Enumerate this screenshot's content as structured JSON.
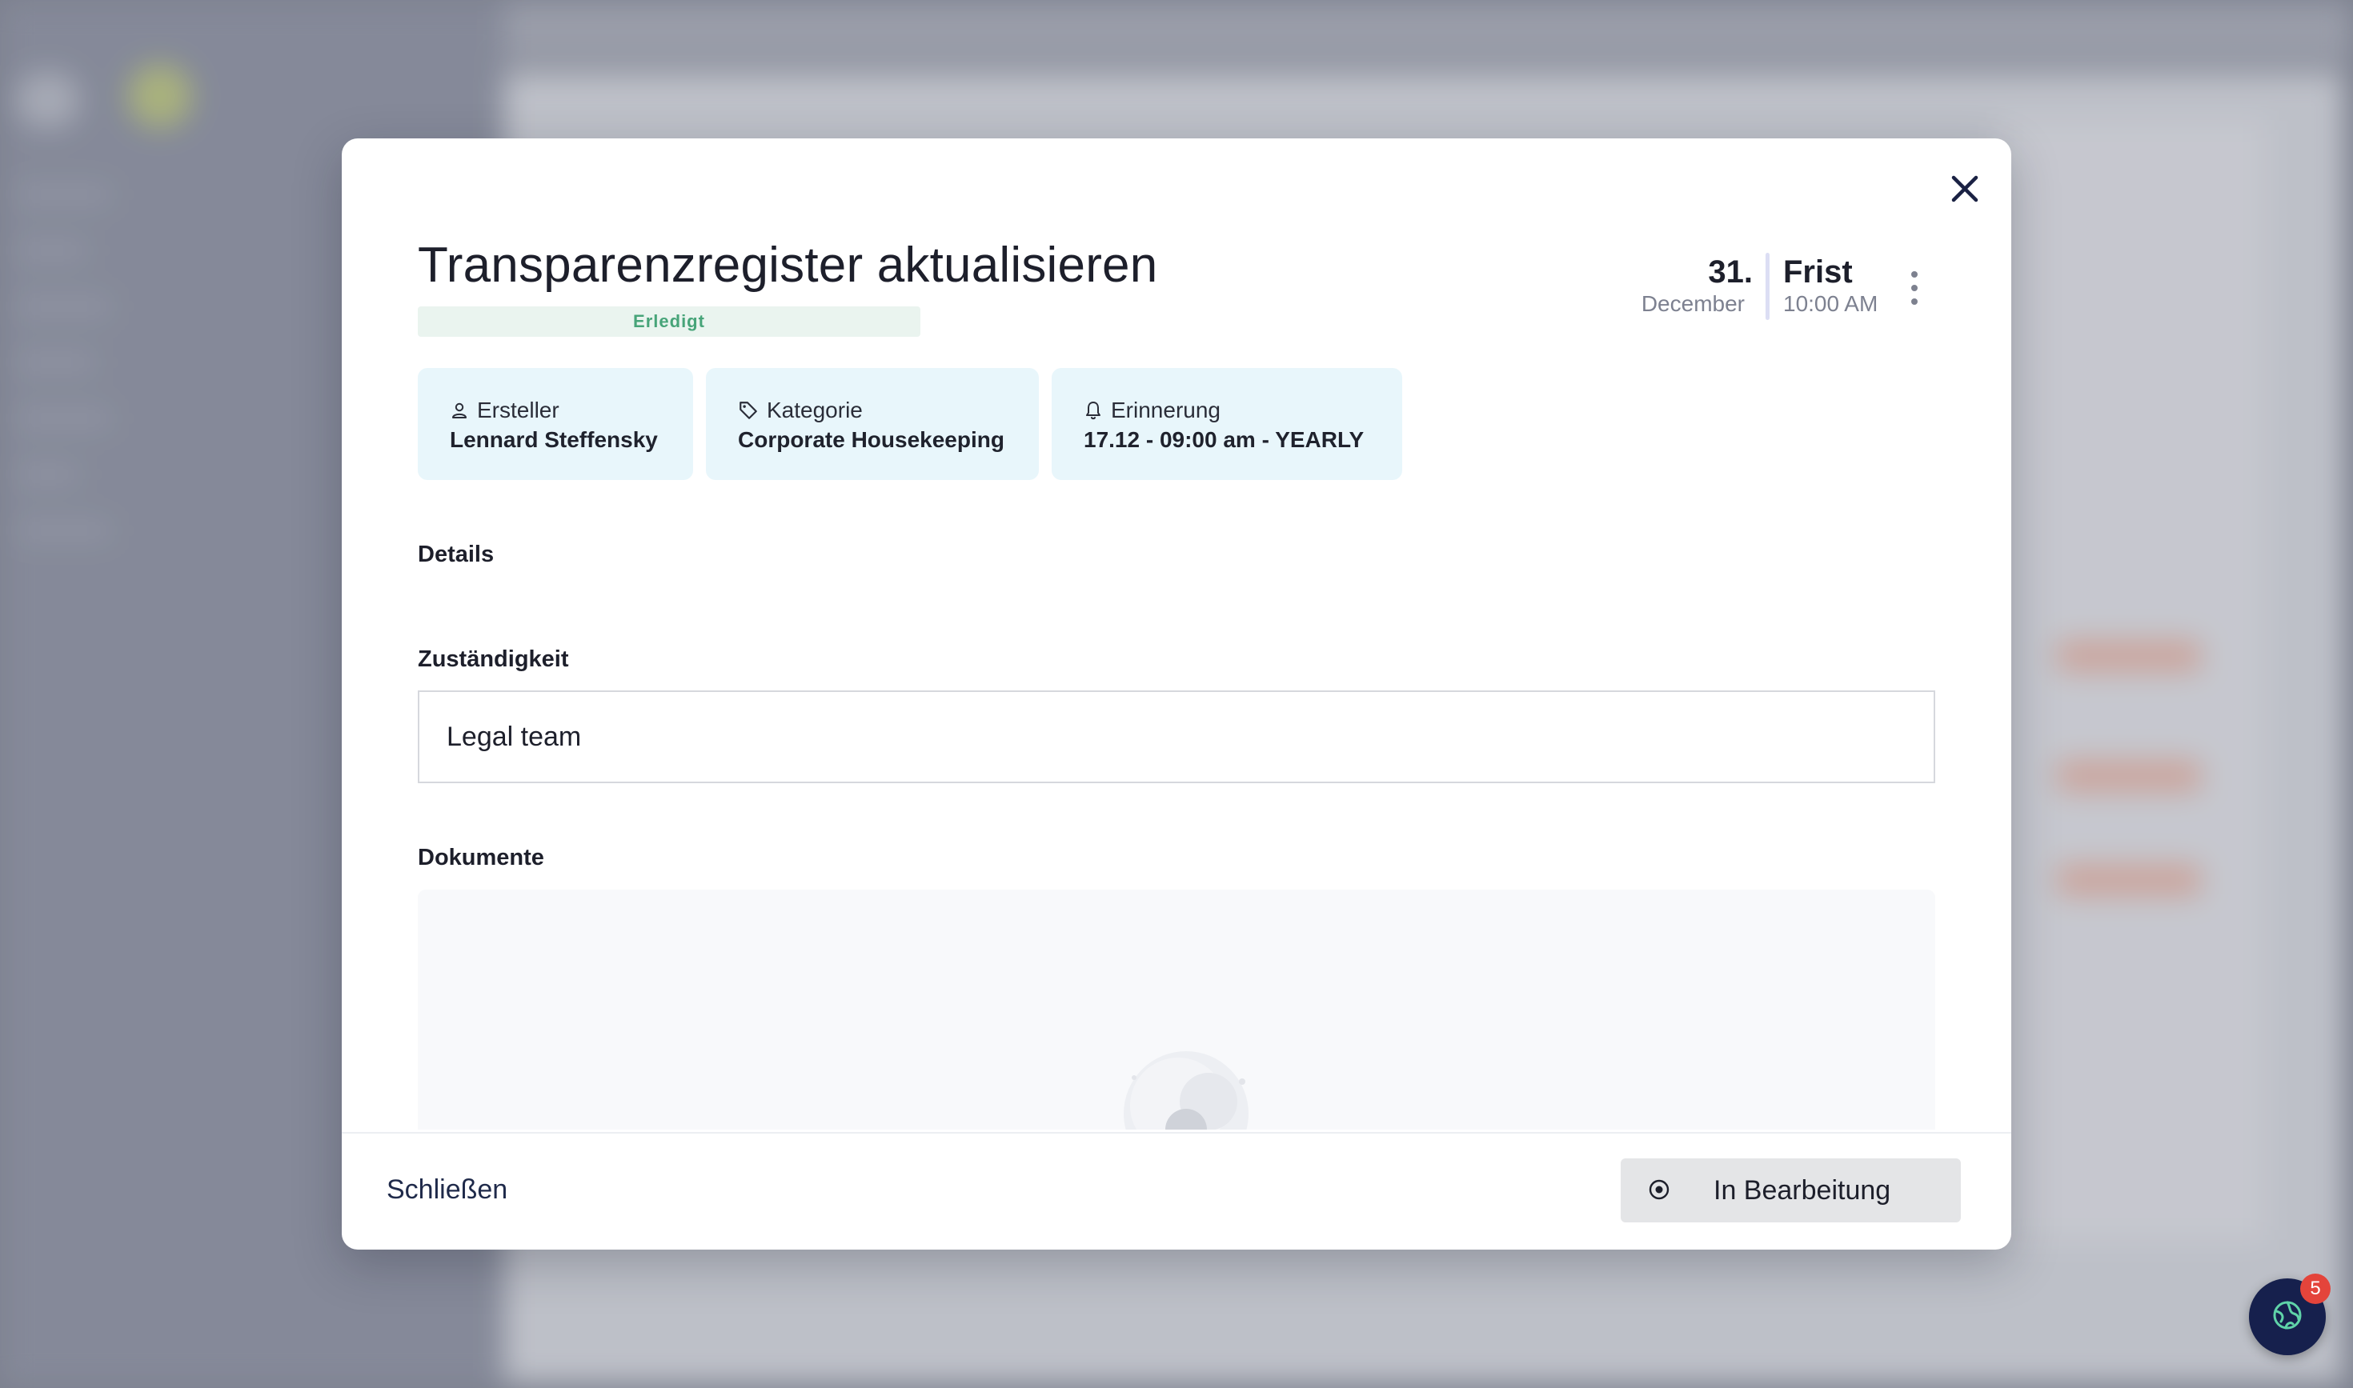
{
  "task": {
    "title": "Transparenzregister aktualisieren",
    "status": "Erledigt"
  },
  "deadline": {
    "day": "31.",
    "month": "December",
    "label": "Frist",
    "time": "10:00 AM"
  },
  "info_cards": {
    "creator": {
      "label": "Ersteller",
      "value": "Lennard Steffensky",
      "icon": "user-icon"
    },
    "category": {
      "label": "Kategorie",
      "value": "Corporate Housekeeping",
      "icon": "tag-icon"
    },
    "reminder": {
      "label": "Erinnerung",
      "value": "17.12 - 09:00 am - YEARLY",
      "icon": "bell-icon"
    }
  },
  "sections": {
    "details_label": "Details",
    "responsibility_label": "Zuständigkeit",
    "responsibility_value": "Legal team",
    "documents_label": "Dokumente"
  },
  "footer": {
    "close_label": "Schließen",
    "status_button_label": "In Bearbeitung",
    "status_button_icon": "radio-dot-icon"
  },
  "chat_widget": {
    "badge_count": "5",
    "icon": "globe-icon"
  },
  "colors": {
    "status_green": "#47a479",
    "status_bg": "#eaf4ef",
    "card_bg": "#e8f6fb",
    "chat_bg": "#16204d",
    "badge_red": "#e4443b"
  }
}
